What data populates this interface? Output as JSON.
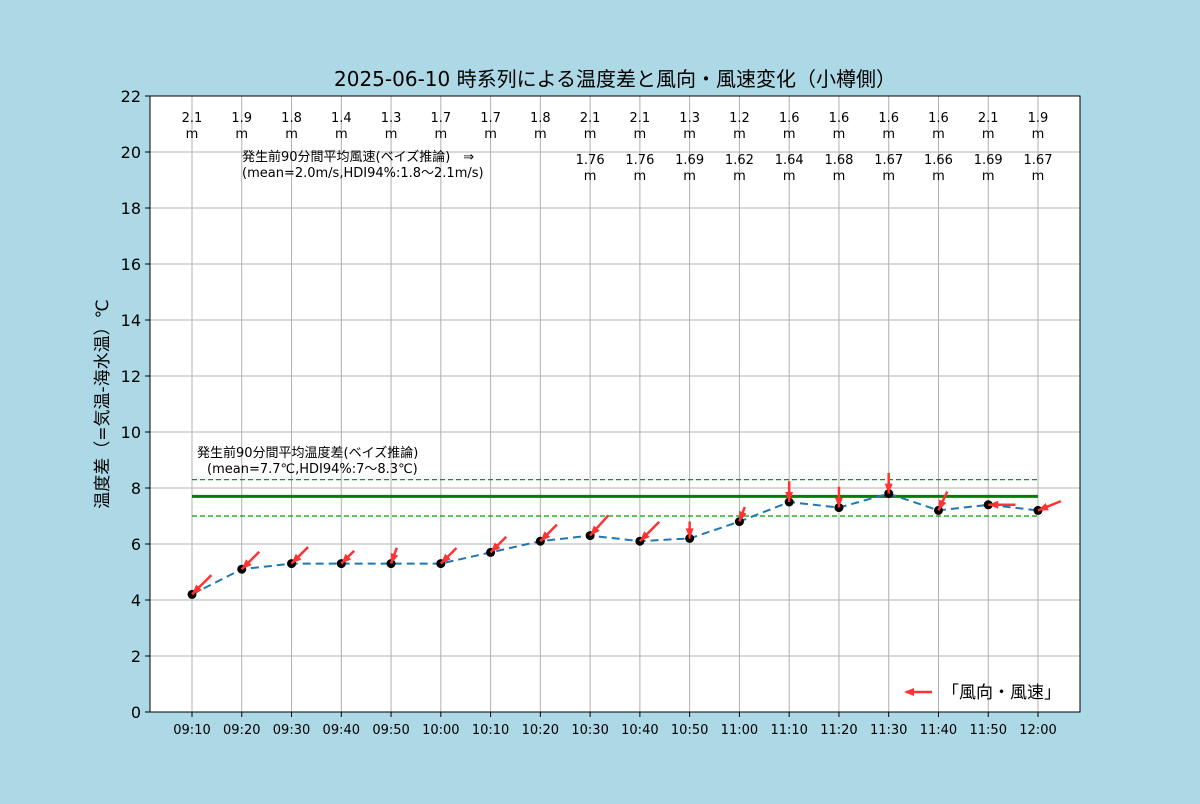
{
  "chart_data": {
    "type": "line",
    "title": "2025-06-10 時系列による温度差と風向・風速変化（小樽側）",
    "xlabel": "",
    "ylabel": "温度差（=気温-海水温）℃",
    "ylim": [
      0,
      22
    ],
    "yticks": [
      0,
      2,
      4,
      6,
      8,
      10,
      12,
      14,
      16,
      18,
      20,
      22
    ],
    "grid": true,
    "categories": [
      "09:10",
      "09:20",
      "09:30",
      "09:40",
      "09:50",
      "10:00",
      "10:10",
      "10:20",
      "10:30",
      "10:40",
      "10:50",
      "11:00",
      "11:10",
      "11:20",
      "11:30",
      "11:40",
      "11:50",
      "12:00"
    ],
    "series": [
      {
        "name": "温度差",
        "color": "#1f77b4",
        "values": [
          4.2,
          5.1,
          5.3,
          5.3,
          5.3,
          5.3,
          5.7,
          6.1,
          6.3,
          6.1,
          6.2,
          6.8,
          7.5,
          7.3,
          7.8,
          7.2,
          7.4,
          7.2
        ]
      }
    ],
    "wind_speed_labels": [
      "2.1",
      "1.9",
      "1.8",
      "1.4",
      "1.3",
      "1.7",
      "1.7",
      "1.8",
      "2.1",
      "2.1",
      "1.3",
      "1.2",
      "1.6",
      "1.6",
      "1.6",
      "1.6",
      "2.1",
      "1.9"
    ],
    "wind_speed_values": [
      2.1,
      1.9,
      1.8,
      1.4,
      1.3,
      1.7,
      1.7,
      1.8,
      2.1,
      2.1,
      1.3,
      1.2,
      1.6,
      1.6,
      1.6,
      1.6,
      2.1,
      1.9
    ],
    "wind_direction_from_deg": [
      45,
      45,
      45,
      45,
      20,
      45,
      45,
      45,
      42,
      45,
      0,
      20,
      0,
      0,
      0,
      25,
      90,
      68
    ],
    "second_row_start_index": 8,
    "second_row_labels": [
      "1.76",
      "1.76",
      "1.69",
      "1.62",
      "1.64",
      "1.68",
      "1.67",
      "1.66",
      "1.69",
      "1.67"
    ],
    "unit_label": "m",
    "wind_annotation": {
      "line1": "発生前90分間平均風速(ベイズ推論)　⇒",
      "line2": "(mean=2.0m/s,HDI94%:1.8〜2.1m/s)"
    },
    "temp_annotation": {
      "line1": "発生前90分間平均温度差(ベイズ推論)",
      "line2": "(mean=7.7℃,HDI94%:7〜8.3℃)"
    },
    "temp_mean": 7.7,
    "temp_hdi": [
      7.0,
      8.3
    ],
    "legend": {
      "label": "「風向・風速」",
      "placement": "bottom-right"
    },
    "colors": {
      "line": "#1f77b4",
      "arrow": "#ff3333",
      "mean": "#008000",
      "hdi": "#00a000",
      "marker": "#000000",
      "grid": "#b0b0b0"
    }
  }
}
